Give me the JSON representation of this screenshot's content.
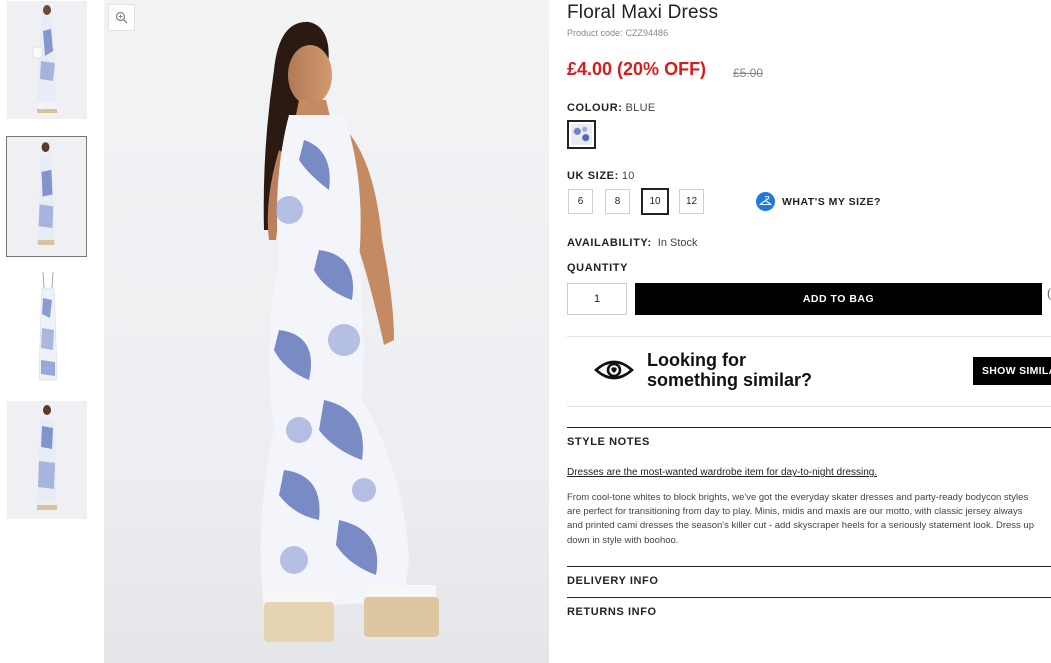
{
  "product": {
    "title": "Floral Maxi Dress",
    "code_label": "Product code:",
    "code_value": "CZZ94486",
    "price_text": "£4.00 (20% OFF)",
    "old_price": "£5.00",
    "price_color": "#d21e1e"
  },
  "colour": {
    "label": "COLOUR:",
    "value": "BLUE",
    "swatch_name": "Blue floral"
  },
  "size": {
    "label": "UK SIZE:",
    "value": "10",
    "options": [
      "6",
      "8",
      "10",
      "12"
    ],
    "selected": "10",
    "guide_label": "WHAT'S MY SIZE?",
    "guide_icon": "hanger-icon"
  },
  "availability": {
    "label": "AVAILABILITY:",
    "value": "In Stock"
  },
  "quantity": {
    "label": "QUANTITY",
    "value": "1"
  },
  "add_to_bag_label": "ADD TO BAG",
  "wishlist_peek": "(",
  "similar": {
    "line1": "Looking for",
    "line2": "something similar?",
    "button_label": "SHOW SIMILAR",
    "icon": "eye-icon"
  },
  "style_notes": {
    "heading": "STYLE NOTES",
    "link_text": "Dresses are the most-wanted wardrobe item for day-to-night dressing.",
    "body_lines": [
      "From cool-tone whites to block brights, we've got the everyday skater dresses and party-ready bodycon styles",
      "are perfect for transitioning from day to play. Minis, midis and maxis are our motto, with classic jersey always",
      "and printed cami dresses the season's killer cut - add skyscraper heels for a seriously statement look. Dress up",
      "down in style with boohoo."
    ]
  },
  "delivery_heading": "DELIVERY INFO",
  "returns_heading": "RETURNS INFO",
  "gallery": {
    "thumb_count": 4,
    "active_index": 1,
    "zoom_icon": "zoom-in-icon"
  },
  "colors": {
    "accent_blue": "#1f7ae0",
    "button_black": "#000000"
  }
}
